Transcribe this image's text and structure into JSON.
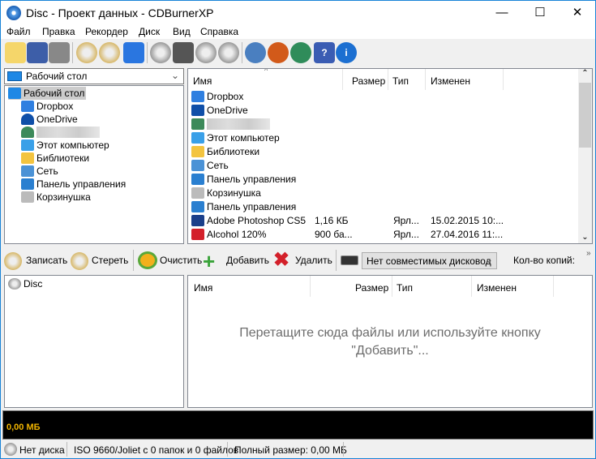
{
  "window": {
    "title": "Disc - Проект данных - CDBurnerXP"
  },
  "menu": [
    "Файл",
    "Правка",
    "Рекордер",
    "Диск",
    "Вид",
    "Справка"
  ],
  "toolbar_icons": [
    "new-project-icon",
    "save-icon",
    "print-icon",
    "erase-disc-icon",
    "verify-disc-icon",
    "window-icon",
    "disc-info-icon",
    "drive-info-icon",
    "import-session-icon",
    "eject-icon",
    "settings-icon",
    "update-icon",
    "web-icon",
    "help-icon",
    "about-icon"
  ],
  "explorer": {
    "location": "Рабочий стол",
    "tree": [
      "Рабочий стол",
      "Dropbox",
      "OneDrive",
      "",
      "Этот компьютер",
      "Библиотеки",
      "Сеть",
      "Панель управления",
      "Корзинушка"
    ],
    "columns": [
      "Имя",
      "Размер",
      "Тип",
      "Изменен"
    ],
    "files": [
      {
        "name": "Dropbox",
        "size": "",
        "type": "",
        "date": ""
      },
      {
        "name": "OneDrive",
        "size": "",
        "type": "",
        "date": ""
      },
      {
        "name": "",
        "size": "",
        "type": "",
        "date": ""
      },
      {
        "name": "Этот компьютер",
        "size": "",
        "type": "",
        "date": ""
      },
      {
        "name": "Библиотеки",
        "size": "",
        "type": "",
        "date": ""
      },
      {
        "name": "Сеть",
        "size": "",
        "type": "",
        "date": ""
      },
      {
        "name": "Панель управления",
        "size": "",
        "type": "",
        "date": ""
      },
      {
        "name": "Корзинушка",
        "size": "",
        "type": "",
        "date": ""
      },
      {
        "name": "Панель управления",
        "size": "",
        "type": "",
        "date": ""
      },
      {
        "name": "Adobe Photoshop CS5",
        "size": "1,16 КБ",
        "type": "Ярл...",
        "date": "15.02.2015 10:..."
      },
      {
        "name": "Alcohol 120%",
        "size": "900 ба...",
        "type": "Ярл...",
        "date": "27.04.2016 11:..."
      }
    ]
  },
  "actions": {
    "burn": "Записать",
    "erase": "Стереть",
    "clear": "Очистить",
    "add": "Добавить",
    "delete": "Удалить",
    "drive": "Нет совместимых дисковод",
    "copies": "Кол-во копий:"
  },
  "compilation": {
    "root": "Disc",
    "columns": [
      "Имя",
      "Размер",
      "Тип",
      "Изменен"
    ],
    "hint1": "Перетащите сюда файлы или используйте кнопку",
    "hint2": "\"Добавить\"..."
  },
  "capacity": "0,00 МБ",
  "status": {
    "disc": "Нет диска",
    "fs": "ISO 9660/Joliet с 0 папок и 0 файлов",
    "size": "Полный размер: 0,00 МБ"
  }
}
